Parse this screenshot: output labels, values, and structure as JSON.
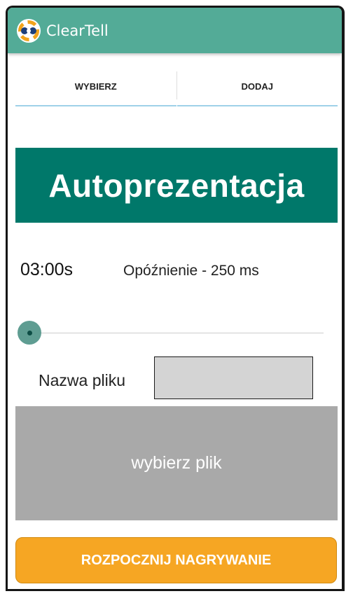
{
  "app": {
    "title": "ClearTell",
    "icon": "cleartell-logo-icon",
    "colors": {
      "appbar": "#53ab97",
      "banner": "#00786a",
      "accent": "#f6a623"
    }
  },
  "tabs": [
    {
      "label": "WYBIERZ"
    },
    {
      "label": "DODAJ"
    }
  ],
  "banner": {
    "text": "Autoprezentacja"
  },
  "status": {
    "timer": "03:00s",
    "delay": "Opóźnienie - 250 ms"
  },
  "slider": {
    "value": 0
  },
  "file": {
    "label": "Nazwa pliku",
    "value": "",
    "choose_label": "wybierz plik"
  },
  "actions": {
    "record_label": "ROZPOCZNIJ NAGRYWANIE"
  }
}
